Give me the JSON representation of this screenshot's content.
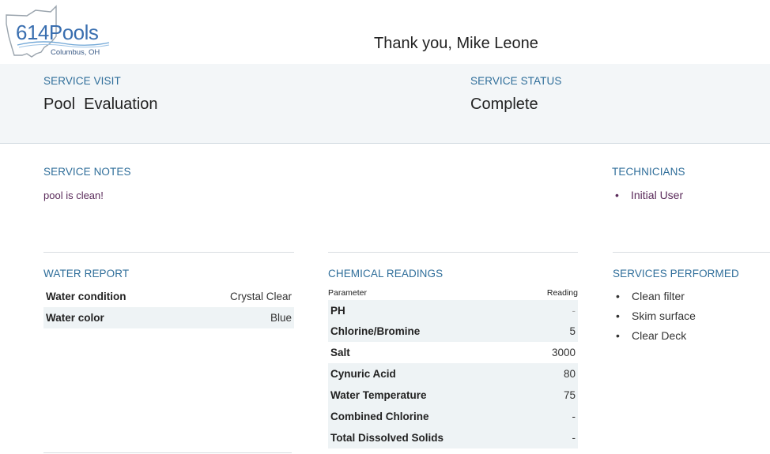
{
  "logo": {
    "name": "614Pools",
    "subtitle": "Columbus, OH"
  },
  "header": {
    "greeting": "Thank you, Mike Leone"
  },
  "visit": {
    "label": "SERVICE VISIT",
    "value": "Pool  Evaluation"
  },
  "status": {
    "label": "SERVICE STATUS",
    "value": "Complete"
  },
  "notes": {
    "label": "SERVICE NOTES",
    "text": "pool is clean!"
  },
  "technicians": {
    "label": "TECHNICIANS",
    "items": [
      "Initial User"
    ]
  },
  "water_report": {
    "label": "WATER REPORT",
    "rows": [
      {
        "key": "Water condition",
        "value": "Crystal Clear"
      },
      {
        "key": "Water color",
        "value": "Blue"
      }
    ]
  },
  "chemical_readings": {
    "label": "CHEMICAL READINGS",
    "col_parameter": "Parameter",
    "col_reading": "Reading",
    "rows": [
      {
        "key": "PH",
        "value": "-"
      },
      {
        "key": "Chlorine/Bromine",
        "value": "5"
      },
      {
        "key": "Salt",
        "value": "3000"
      },
      {
        "key": "Cynuric Acid",
        "value": "80"
      },
      {
        "key": "Water Temperature",
        "value": "75"
      },
      {
        "key": "Combined Chlorine",
        "value": "-"
      },
      {
        "key": "Total Dissolved Solids",
        "value": "-"
      }
    ]
  },
  "services_performed": {
    "label": "SERVICES PERFORMED",
    "items": [
      "Clean filter",
      "Skim surface",
      "Clear Deck"
    ]
  },
  "colors": {
    "accent": "#2f6e9a",
    "band": "#f3f6f8",
    "note_text": "#5a2a5a",
    "logo_blue": "#3a6fb0"
  },
  "icons": {
    "logo_outline": "ohio-state-outline-icon"
  }
}
